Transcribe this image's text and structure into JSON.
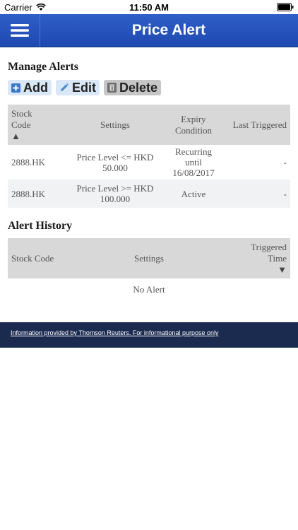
{
  "status_bar": {
    "carrier": "Carrier",
    "time": "11:50 AM"
  },
  "nav": {
    "title": "Price Alert",
    "menu_icon": "hamburger-menu-icon"
  },
  "manage_alerts": {
    "heading": "Manage Alerts",
    "buttons": {
      "add": "Add",
      "edit": "Edit",
      "delete": "Delete"
    },
    "columns": {
      "stock_code": "Stock Code",
      "settings": "Settings",
      "expiry": "Expiry Condition",
      "last_triggered": "Last Triggered",
      "sort_indicator": "▲"
    },
    "rows": [
      {
        "stock_code": "2888.HK",
        "settings": "Price Level <= HKD 50.000",
        "expiry": "Recurring until 16/08/2017",
        "last_triggered": "-"
      },
      {
        "stock_code": "2888.HK",
        "settings": "Price Level >= HKD 100.000",
        "expiry": "Active",
        "last_triggered": "-"
      }
    ]
  },
  "alert_history": {
    "heading": "Alert History",
    "columns": {
      "stock_code": "Stock Code",
      "settings": "Settings",
      "triggered_time": "Triggered Time",
      "sort_indicator": "▼"
    },
    "empty_text": "No Alert"
  },
  "footer": {
    "link_text": "Information provided by Thomson Reuters. For informational purpose only"
  },
  "colors": {
    "nav_background": "#2455bf",
    "footer_background": "#1b2a4f",
    "table_header": "#d8d8d8",
    "alt_row": "#f1f2f4",
    "button_light_blue": "#d9e7f6",
    "button_grey": "#c6c6c6"
  }
}
